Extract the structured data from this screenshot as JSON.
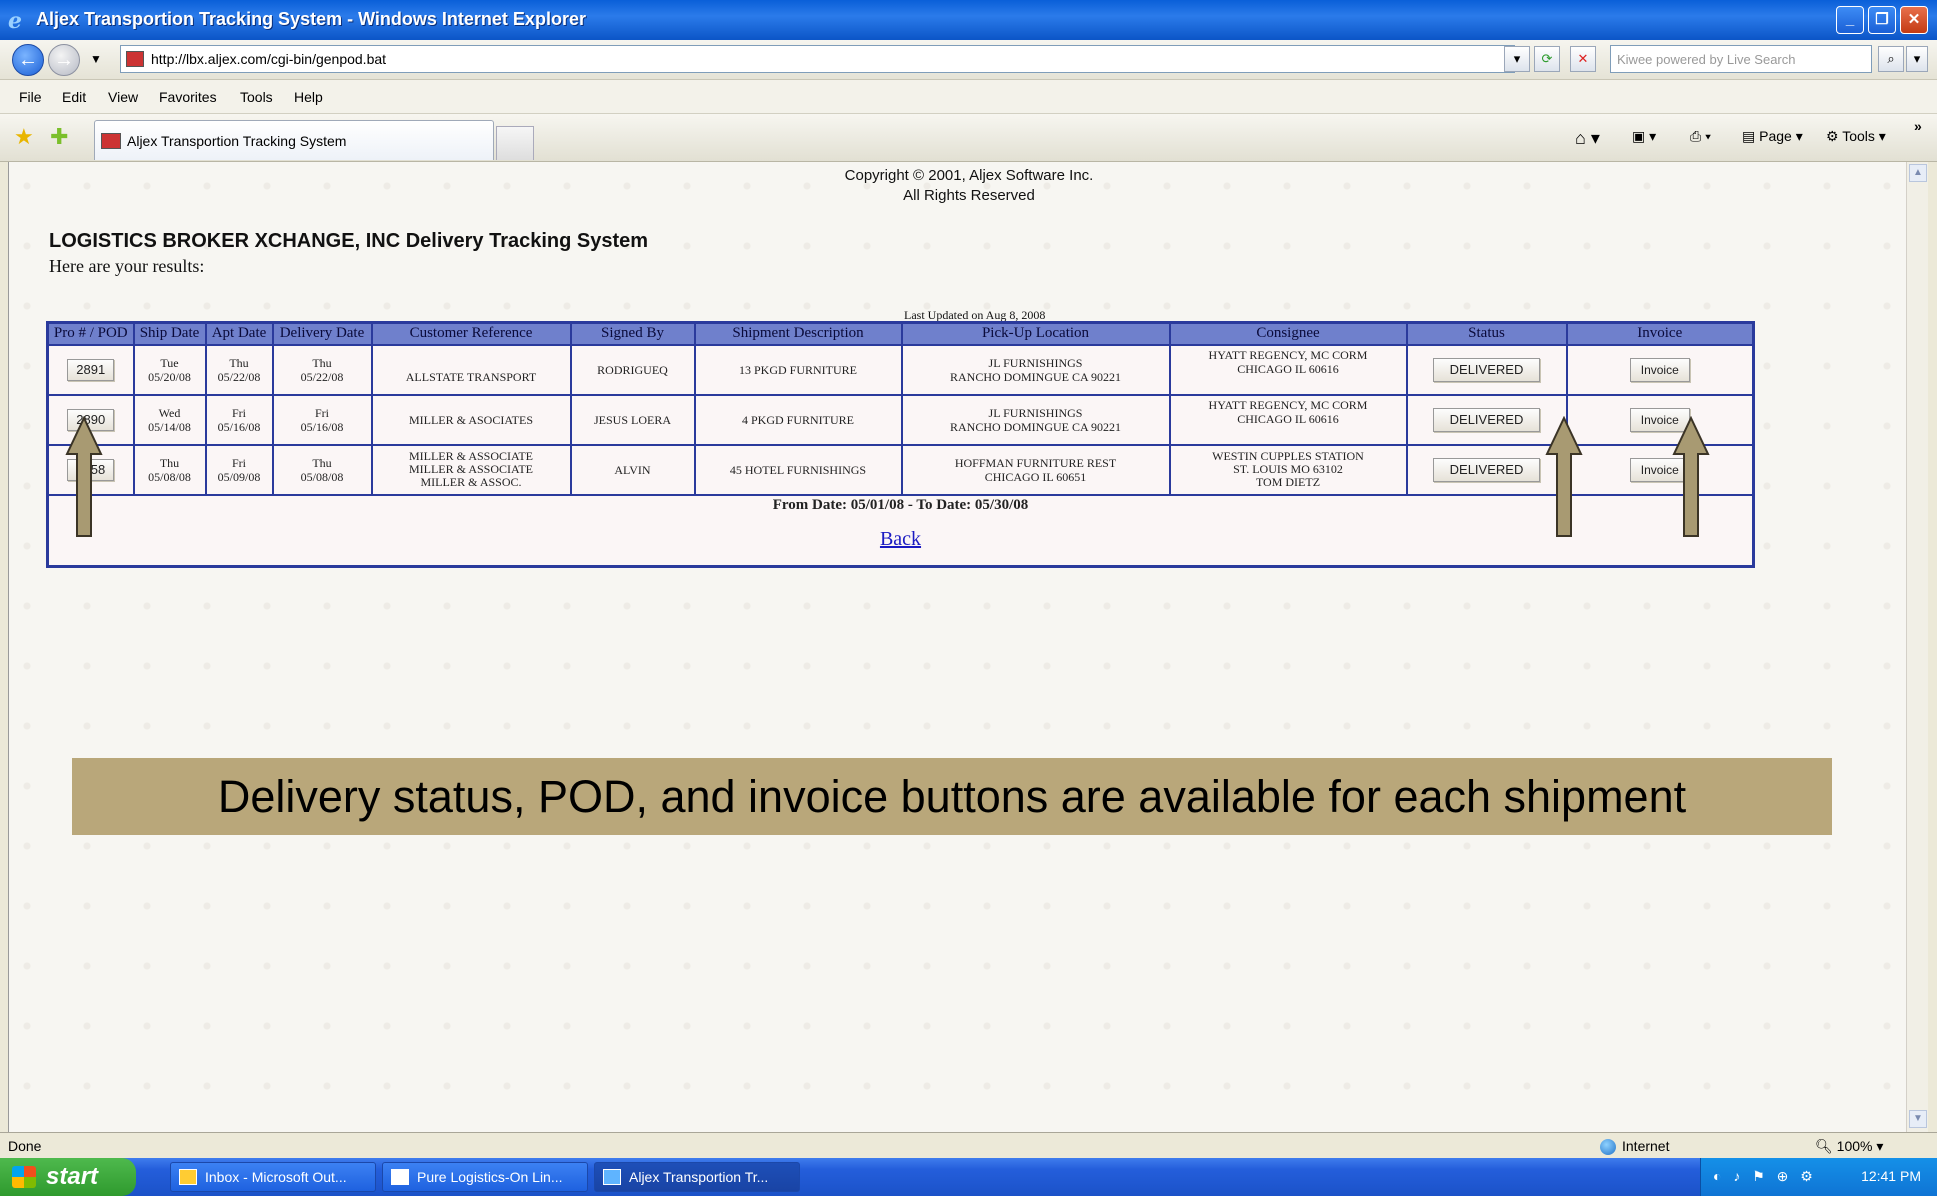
{
  "window": {
    "title": "Aljex Transportion Tracking System - Windows Internet Explorer"
  },
  "addressbar": {
    "url": "http://lbx.aljex.com/cgi-bin/genpod.bat",
    "search_placeholder": "Kiwee powered by Live Search"
  },
  "menu": {
    "items": [
      "File",
      "Edit",
      "View",
      "Favorites",
      "Tools",
      "Help"
    ]
  },
  "tab": {
    "label": "Aljex Transportion Tracking System"
  },
  "commandbar": {
    "page_label": "Page",
    "tools_label": "Tools"
  },
  "page": {
    "copyright_line1": "Copyright © 2001, Aljex Software Inc.",
    "copyright_line2": "All Rights Reserved",
    "company_title": "LOGISTICS BROKER XCHANGE, INC Delivery Tracking System",
    "results_label": "Here are your results:",
    "last_updated": "Last Updated on Aug 8, 2008",
    "table": {
      "columns": [
        "Pro # / POD",
        "Ship Date",
        "Apt Date",
        "Delivery Date",
        "Customer Reference",
        "Signed By",
        "Shipment Description",
        "Pick-Up Location",
        "Consignee",
        "Status",
        "Invoice"
      ],
      "rows": [
        {
          "pro": "2891",
          "ship_day": "Tue",
          "ship_date": "05/20/08",
          "apt_day": "Thu",
          "apt_date": "05/22/08",
          "del_day": "Thu",
          "del_date": "05/22/08",
          "customer_ref": [
            "",
            "ALLSTATE TRANSPORT"
          ],
          "signed_by": "RODRIGUEQ",
          "description": "13 PKGD FURNITURE",
          "pickup": [
            "JL FURNISHINGS",
            "RANCHO DOMINGUE  CA  90221"
          ],
          "consignee": [
            "HYATT REGENCY, MC CORM",
            "CHICAGO  IL  60616"
          ],
          "status": "DELIVERED",
          "invoice": "Invoice"
        },
        {
          "pro": "2890",
          "ship_day": "Wed",
          "ship_date": "05/14/08",
          "apt_day": "Fri",
          "apt_date": "05/16/08",
          "del_day": "Fri",
          "del_date": "05/16/08",
          "customer_ref": [
            "MILLER & ASOCIATES"
          ],
          "signed_by": "JESUS LOERA",
          "description": "4 PKGD FURNITURE",
          "pickup": [
            "JL FURNISHINGS",
            "RANCHO DOMINGUE  CA  90221"
          ],
          "consignee": [
            "HYATT REGENCY, MC CORM",
            "CHICAGO  IL  60616"
          ],
          "status": "DELIVERED",
          "invoice": "Invoice"
        },
        {
          "pro": "2858",
          "ship_day": "Thu",
          "ship_date": "05/08/08",
          "apt_day": "Fri",
          "apt_date": "05/09/08",
          "del_day": "Thu",
          "del_date": "05/08/08",
          "customer_ref": [
            "MILLER & ASSOCIATE",
            "MILLER & ASSOCIATE",
            "MILLER & ASSOC."
          ],
          "signed_by": "ALVIN",
          "description": "45 HOTEL FURNISHINGS",
          "pickup": [
            "HOFFMAN FURNITURE REST",
            "CHICAGO  IL  60651"
          ],
          "consignee": [
            "WESTIN CUPPLES STATION",
            "ST. LOUIS  MO  63102",
            "TOM DIETZ"
          ],
          "status": "DELIVERED",
          "invoice": "Invoice"
        }
      ]
    },
    "date_range": "From Date: 05/01/08 - To Date: 05/30/08",
    "back_link": "Back",
    "banner": "Delivery status, POD, and invoice buttons are available for each shipment"
  },
  "statusbar": {
    "left": "Done",
    "zone": "Internet",
    "zoom": "100%"
  },
  "taskbar": {
    "start": "start",
    "tasks": [
      "Inbox - Microsoft Out...",
      "Pure Logistics-On Lin...",
      "Aljex Transportion Tr..."
    ],
    "clock": "12:41 PM"
  },
  "colors": {
    "table_border": "#2a3a9c",
    "header_bg": "#6f80cc",
    "banner_bg": "#b9a77a",
    "arrow": "#a89a72"
  }
}
